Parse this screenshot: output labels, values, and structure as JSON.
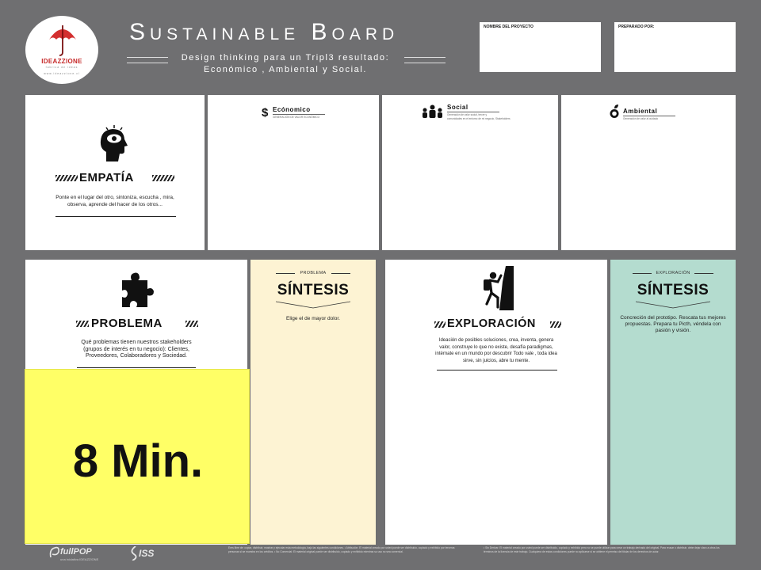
{
  "header": {
    "logo": {
      "name": "IDEAZZIONE",
      "tagline": "fabrica de ideas",
      "url": "www.ideazzione.cl",
      "umbrella_color": "#d32f2f"
    },
    "title": "Sustainable Board",
    "subtitle_line1": "Design thinking para un Tripl3 resultado:",
    "subtitle_line2": "Económico , Ambiental  y Social.",
    "project_label": "NOMBRE DEL PROYECTO",
    "prepared_label": "PREPARADO POR:"
  },
  "top_row": {
    "empatia": {
      "icon": "head-eye-icon",
      "title": "EMPATÍA",
      "description": "Ponte en el lugar del otro, sintoniza, escucha , mira, observa, aprende del hacer de los otros..."
    },
    "economico": {
      "icon": "dollar-icon",
      "title": "Ecónomico",
      "subtitle": "GENERACIÓN DE VALOR ECONÓMICO"
    },
    "social": {
      "icon": "people-icon",
      "title": "Social",
      "subtitle1": "Generación de valor social, tercer y",
      "subtitle2": "comunidades en el entorno de mi negocio, Stakeholders"
    },
    "ambiental": {
      "icon": "leaf-recycle-icon",
      "title": "Ambiental",
      "subtitle": "Generación de valor al cuidado"
    }
  },
  "bottom_row": {
    "problema": {
      "icon": "puzzle-icon",
      "title": "PROBLEMA",
      "description": "Qué problemas tienen nuestros stakeholders (grupos de interés en tu negocio): Clientes, Proveedores, Colaboradores y Sociedad."
    },
    "sintesis_problema": {
      "top_label": "PROBLEMA",
      "title": "SÍNTESIS",
      "description": "Elige el de mayor dolor.",
      "bg": "#fdf3d3"
    },
    "exploracion": {
      "icon": "climber-icon",
      "title": "EXPLORACIÓN",
      "description": "Ideación de posibles soluciones, crea, inventa, genera valor, construye lo que no existe, desafía paradigmas, intérnate en un mundo por descubrir Todo vale , toda idea sirve, sin juicios, abre tu mente."
    },
    "sintesis_exploracion": {
      "top_label": "EXPLORACIÓN",
      "title": "SÍNTESIS",
      "description": "Concreción del prototipo. Rescata tus mejores propuestas. Prepara tu Picth, véndela con pasión y visión.",
      "bg": "#b4dccf"
    }
  },
  "timer": {
    "label": "8 Min.",
    "bg": "#ffff66"
  },
  "footer": {
    "logo1": "fullPOP",
    "logo1_sub": "una iniciativa IDEAZZIONE",
    "logo2": "ISS",
    "text_left": "Eres libre de: copiar, distribuir, mostrar y ejecutar esta metodología, bajo las siguientes condiciones. • Atribución: El material creado por usted puede ser distribuido, copiado y exhibido por terceras personas si se muestra en los créditos. • No Comercial: El material original puede ser distribuido, copiado y exhibido mientras su uso no sea comercial.",
    "text_right": "• Sin Derivar: El material creado por usted puede ser distribuido, copiado y exhibido pero no se puede utilizar para crear un trabajo derivado del original. Para reusar o distribuir, debe dejar claro a otros los términos de la licencia de este trabajo. Cualquiera de estas condiciones puede no aplicarse si se obtiene el permiso del titular de los derechos de autor."
  }
}
